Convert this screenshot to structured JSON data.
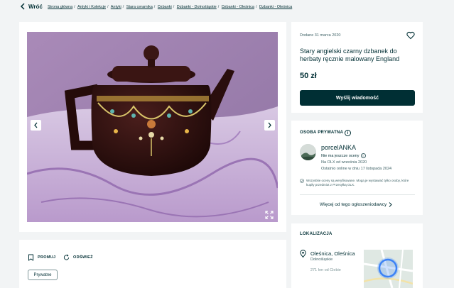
{
  "nav": {
    "back_label": "Wróć",
    "breadcrumbs": [
      "Strona główna",
      "Antyki i Kolekcje",
      "Antyki",
      "Stara ceramika",
      "Dzbanki",
      "Dzbanki - Dolnośląskie",
      "Dzbanki - Oleśnica",
      "Dzbanki - Oleśnica"
    ]
  },
  "actions": {
    "promote_label": "PROMUJ",
    "refresh_label": "ODŚWIEŻ",
    "seller_type_tag": "Prywatne"
  },
  "listing": {
    "date": "Dodane 31 marca 2020",
    "title": "Stary angielski czarny dzbanek do herbaty ręcznie malowany England",
    "price": "50 zł",
    "message_button": "Wyślij wiadomość"
  },
  "seller": {
    "section_label": "OSOBA PRYWATNA",
    "info_glyph": "i",
    "name": "porcelANKA",
    "rating": "Nie ma jeszcze oceny",
    "member_since": "Na OLX od września 2020",
    "last_online": "Ostatnio online w dniu 17 listopada 2024",
    "verification_note": "Wszystkie oceny są weryfikowane. Mogą je wystawiać tylko osoby, które kupiły przedmiot z Przesyłką OLX.",
    "more_listings": "Więcej od tego ogłoszeniodawcy"
  },
  "location": {
    "section_label": "LOKALIZACJA",
    "city": "Oleśnica, Oleśnica",
    "region": "Dolnośląskie",
    "distance": "271 km od Ciebie"
  },
  "colors": {
    "brand_dark": "#002f34",
    "page_bg": "#f2f4f5",
    "card_bg": "#ffffff",
    "map_marker": "#3b82f6"
  },
  "icons": [
    "chevron-left-icon",
    "chevron-right-icon",
    "heart-icon",
    "expand-icon",
    "bookmark-icon",
    "refresh-icon",
    "info-icon",
    "check-shield-icon",
    "location-pin-icon",
    "chevron-right-small-icon"
  ]
}
